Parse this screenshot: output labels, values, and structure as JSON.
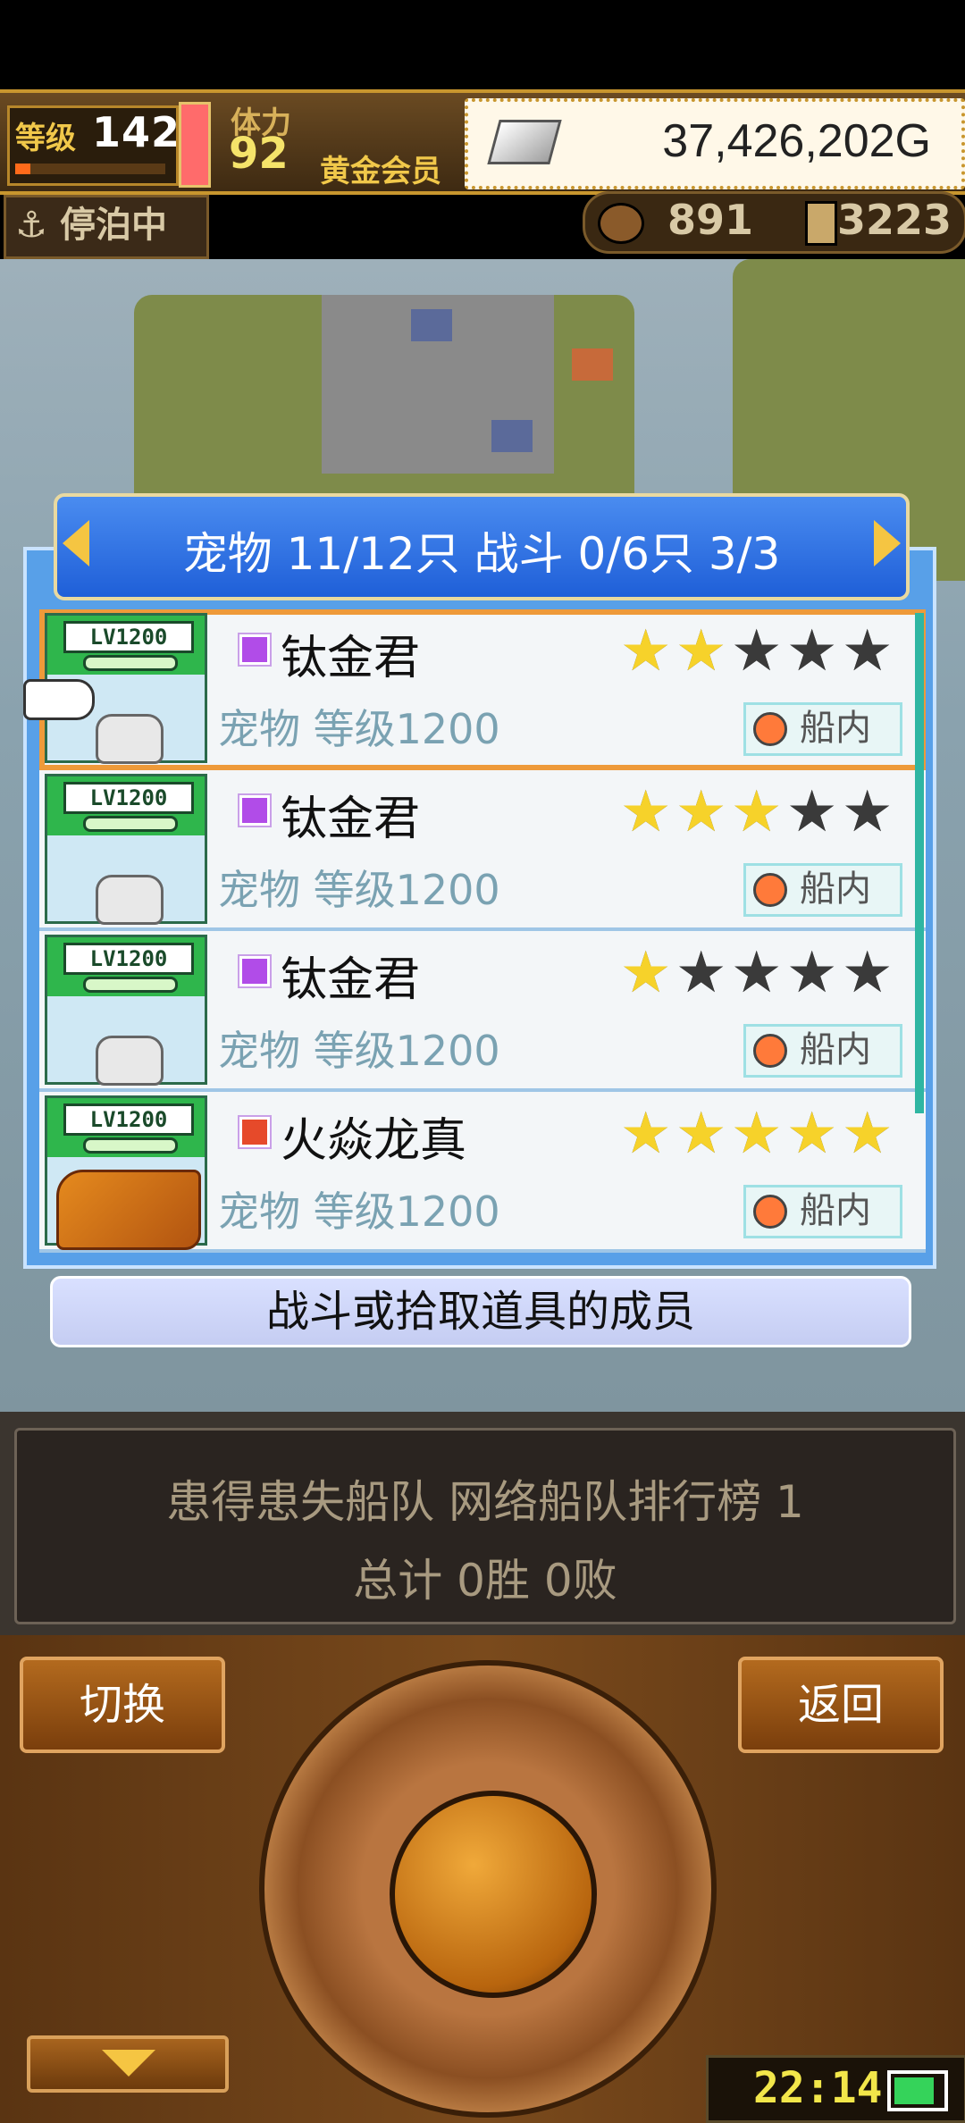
{
  "status": {
    "level_label": "等级",
    "level": "142",
    "level_progress": 0.1,
    "stamina_label": "体力",
    "stamina": "92",
    "vip": "黄金会员",
    "gold": "37,426,202G",
    "dock_status": "停泊中",
    "food": "891",
    "wood": "3223"
  },
  "panel": {
    "title": "宠物 11/12只 战斗 0/6只  3/3",
    "rows": [
      {
        "lv": "LV1200",
        "name": "钛金君",
        "element": "purple",
        "sub": "宠物 等级1200",
        "stars": 2,
        "location": "船内",
        "selected": true
      },
      {
        "lv": "LV1200",
        "name": "钛金君",
        "element": "purple",
        "sub": "宠物 等级1200",
        "stars": 3,
        "location": "船内",
        "selected": false
      },
      {
        "lv": "LV1200",
        "name": "钛金君",
        "element": "purple",
        "sub": "宠物 等级1200",
        "stars": 1,
        "location": "船内",
        "selected": false
      },
      {
        "lv": "LV1200",
        "name": "火焱龙真",
        "element": "fire",
        "sub": "宠物 等级1200",
        "stars": 5,
        "location": "船内",
        "selected": false
      }
    ],
    "members_button": "战斗或拾取道具的成员"
  },
  "info": {
    "line1": "患得患失船队  网络船队排行榜  1",
    "line2": "总计 0胜 0败"
  },
  "controls": {
    "switch_label": "切换",
    "back_label": "返回",
    "clock": "22:14"
  },
  "colors": {
    "header_blue": "#1f5fd8",
    "selected_outline": "#ee9a3a",
    "star_on": "#f6d22a",
    "star_off": "#3a3a3a"
  },
  "icons": [
    "anchor-icon",
    "food-icon",
    "wood-icon",
    "silver-bar-icon",
    "element-icon",
    "location-pin-icon",
    "pointing-hand-icon",
    "down-arrow-icon",
    "battery-icon"
  ]
}
